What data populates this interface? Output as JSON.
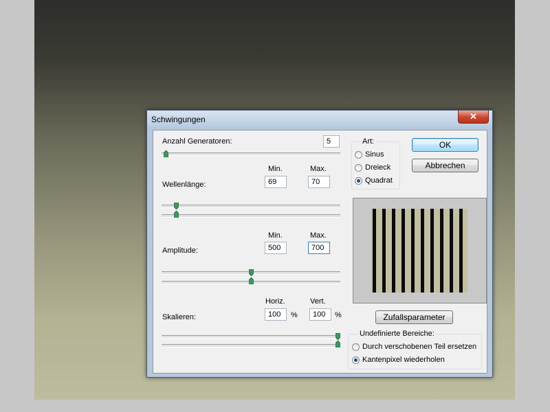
{
  "dialog": {
    "title": "Schwingungen",
    "close_glyph": "✕"
  },
  "generators": {
    "label": "Anzahl Generatoren:",
    "value": "5",
    "slider_fraction": 0.01
  },
  "wavelength": {
    "label": "Wellenlänge:",
    "min_label": "Min.",
    "max_label": "Max.",
    "min_value": "69",
    "max_value": "70",
    "slider_min_fraction": 0.07,
    "slider_max_fraction": 0.07
  },
  "amplitude": {
    "label": "Amplitude:",
    "min_label": "Min.",
    "max_label": "Max.",
    "min_value": "500",
    "max_value": "700",
    "slider_min_fraction": 0.5,
    "slider_max_fraction": 0.5
  },
  "scale": {
    "label": "Skalieren:",
    "horiz_label": "Horiz.",
    "vert_label": "Vert.",
    "horiz_value": "100",
    "vert_value": "100",
    "unit": "%",
    "slider_h_fraction": 1.0,
    "slider_v_fraction": 1.0
  },
  "type_group": {
    "title": "Art:",
    "options": [
      {
        "label": "Sinus",
        "selected": false
      },
      {
        "label": "Dreieck",
        "selected": false
      },
      {
        "label": "Quadrat",
        "selected": true
      }
    ]
  },
  "buttons": {
    "ok": "OK",
    "cancel": "Abbrechen",
    "randomize": "Zufallsparameter"
  },
  "undefined_areas": {
    "title": "Undefinierte Bereiche:",
    "options": [
      {
        "label": "Durch verschobenen Teil ersetzen",
        "selected": false
      },
      {
        "label": "Kantenpixel wiederholen",
        "selected": true
      }
    ]
  },
  "preview": {
    "stripe_count": 10
  },
  "colors": {
    "preview_background": "#c2bfa3",
    "stripe": "#0a0a0a",
    "slider_thumb": "#3a9a5c",
    "selected_radio": "#1f4f82"
  }
}
